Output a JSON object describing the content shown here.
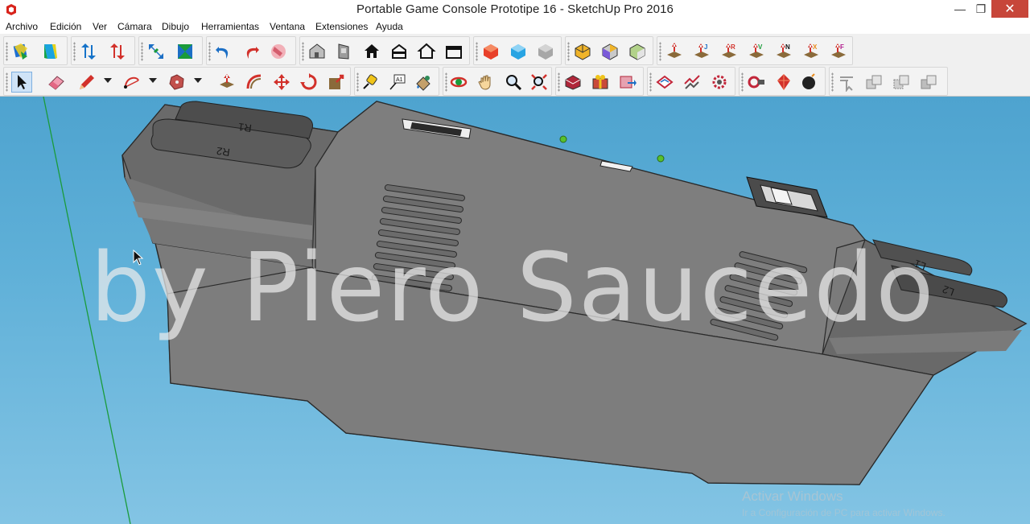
{
  "window": {
    "title": "Portable Game Console Prototipe 16 - SketchUp Pro 2016",
    "minimize": "—",
    "maximize": "❐",
    "close": "✕"
  },
  "menu": [
    "Archivo",
    "Edición",
    "Ver",
    "Cámara",
    "Dibujo",
    "Herramientas",
    "Ventana",
    "Extensiones",
    "Ayuda"
  ],
  "toolbar_row1": {
    "tools": [
      "get-models-icon",
      "share-model-icon",
      "move-up-down-icon",
      "red-arrows-icon",
      "scale-arrows-icon",
      "section-icon",
      "undo-icon",
      "redo-icon",
      "eraser-pink-icon",
      "house-3d-icon",
      "door-icon",
      "house-outline-icon",
      "house-side-icon",
      "house-front-icon",
      "box-icon",
      "red-cube-icon",
      "blue-cube-icon",
      "gray-cube-icon",
      "yellow-cube-icon",
      "cut-cube-icon",
      "green-cube-icon",
      "arrow-plane-icon",
      "arrow-j-icon",
      "arrow-r-icon",
      "arrow-v-icon",
      "arrow-n-icon",
      "arrow-x-icon",
      "arrow-f-icon"
    ]
  },
  "toolbar_row2": {
    "tools": [
      "select-icon",
      "eraser-icon",
      "pencil-icon",
      "arc-icon",
      "polygon-icon",
      "pushpull-icon",
      "follow-me-icon",
      "move-icon",
      "rotate-icon",
      "scale-icon",
      "tape-icon",
      "text-icon",
      "paint-icon",
      "orbit-icon",
      "pan-icon",
      "zoom-icon",
      "zoom-extents-icon",
      "component-red-icon",
      "component-gift-icon",
      "component-export-icon",
      "sandbox-icon",
      "stamp-icon",
      "gear-cog-icon",
      "solid-tools-icon",
      "ruby-icon",
      "bomb-icon",
      "intersect-icon",
      "union-icon",
      "subtract-icon",
      "trim-icon"
    ]
  },
  "scene": {
    "watermark": "by Piero Saucedo",
    "buttons": [
      "R1",
      "R2",
      "L1",
      "L2"
    ],
    "sky_color": "#5aaed7",
    "body_color": "#7a7a7a"
  },
  "activation": {
    "title": "Activar Windows",
    "subtitle": "Ir a Configuración de PC para activar Windows."
  }
}
